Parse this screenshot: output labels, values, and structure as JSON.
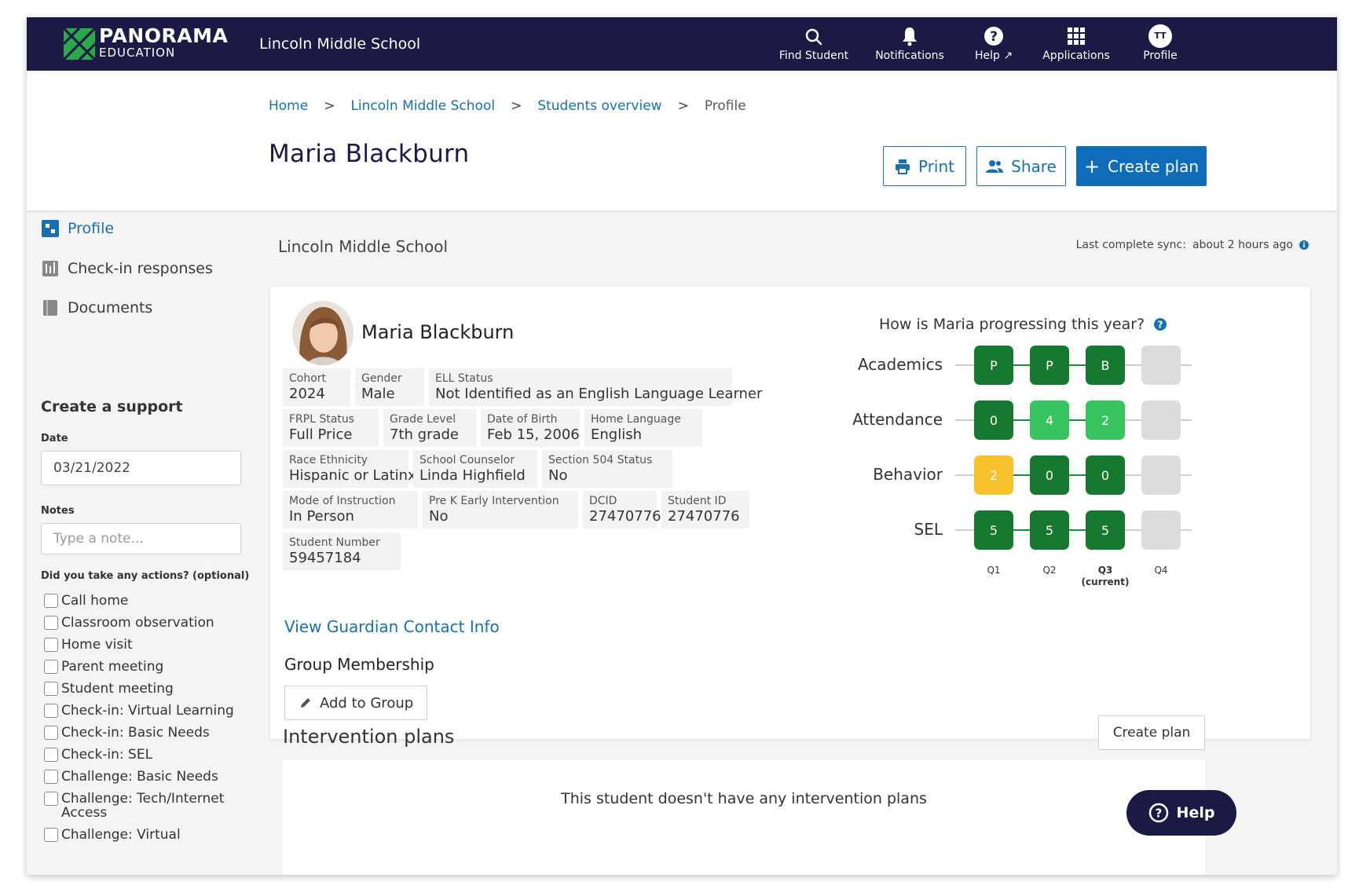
{
  "nav": {
    "brand_line1": "PANORAMA",
    "brand_line2": "EDUCATION",
    "school": "Lincoln Middle School",
    "items": [
      {
        "label": "Find Student",
        "icon": "search-icon"
      },
      {
        "label": "Notifications",
        "icon": "bell-icon"
      },
      {
        "label": "Help",
        "icon": "question-icon"
      },
      {
        "label": "Applications",
        "icon": "grid-icon"
      },
      {
        "label": "Profile",
        "icon": "avatar",
        "initials": "TT"
      }
    ]
  },
  "breadcrumb": [
    "Home",
    "Lincoln Middle School",
    "Students overview",
    "Profile"
  ],
  "breadcrumb_sep": ">",
  "page_title": "Maria Blackburn",
  "actions": {
    "print": "Print",
    "share": "Share",
    "create_plan": "Create plan"
  },
  "sidebar": {
    "links": [
      "Profile",
      "Check-in responses",
      "Documents"
    ],
    "support_title": "Create a support",
    "date_label": "Date",
    "date_value": "03/21/2022",
    "notes_label": "Notes",
    "notes_placeholder": "Type a note...",
    "actions_label": "Did you take any actions? (optional)",
    "checkboxes": [
      "Call home",
      "Classroom observation",
      "Home visit",
      "Parent meeting",
      "Student meeting",
      "Check-in: Virtual Learning",
      "Check-in: Basic Needs",
      "Check-in: SEL",
      "Challenge: Basic Needs",
      "Challenge: Tech/Internet Access",
      "Challenge: Virtual"
    ]
  },
  "content": {
    "school": "Lincoln Middle School",
    "sync_label": "Last complete sync:",
    "sync_value": "about 2 hours ago"
  },
  "student": {
    "name": "Maria Blackburn",
    "fields": [
      {
        "k": "Cohort",
        "v": "2024"
      },
      {
        "k": "Gender",
        "v": "Male"
      },
      {
        "k": "ELL Status",
        "v": "Not Identified as an English Language Learner"
      },
      {
        "k": "FRPL Status",
        "v": "Full Price"
      },
      {
        "k": "Grade Level",
        "v": "7th grade"
      },
      {
        "k": "Date of Birth",
        "v": "Feb 15, 2006"
      },
      {
        "k": "Home Language",
        "v": "English"
      },
      {
        "k": "Race Ethnicity",
        "v": "Hispanic or Latinx"
      },
      {
        "k": "School Counselor",
        "v": "Linda Highfield"
      },
      {
        "k": "Section 504 Status",
        "v": "No"
      },
      {
        "k": "Mode of Instruction",
        "v": "In Person"
      },
      {
        "k": "Pre K Early Intervention",
        "v": "No"
      },
      {
        "k": "DCID",
        "v": "27470776"
      },
      {
        "k": "Student ID",
        "v": "27470776"
      },
      {
        "k": "Student Number",
        "v": "59457184"
      }
    ],
    "guardian_link": "View Guardian Contact Info",
    "group_title": "Group Membership",
    "add_group": "Add to Group"
  },
  "progress": {
    "question": "How is Maria progressing this year?",
    "rows": [
      {
        "label": "Academics",
        "values": [
          "P",
          "P",
          "B",
          ""
        ],
        "colors": [
          "#17782f",
          "#17782f",
          "#17782f",
          "#dcdcdc"
        ]
      },
      {
        "label": "Attendance",
        "values": [
          "0",
          "4",
          "2",
          ""
        ],
        "colors": [
          "#17782f",
          "#38c35f",
          "#38c35f",
          "#dcdcdc"
        ]
      },
      {
        "label": "Behavior",
        "values": [
          "2",
          "0",
          "0",
          ""
        ],
        "colors": [
          "#f6c22d",
          "#17782f",
          "#17782f",
          "#dcdcdc"
        ]
      },
      {
        "label": "SEL",
        "values": [
          "5",
          "5",
          "5",
          ""
        ],
        "colors": [
          "#17782f",
          "#17782f",
          "#17782f",
          "#dcdcdc"
        ]
      }
    ],
    "quarters": [
      "Q1",
      "Q2",
      "Q3",
      "Q4"
    ],
    "current_note": "(current)"
  },
  "interventions": {
    "title": "Intervention plans",
    "create_plan": "Create plan",
    "empty": "This student doesn't have any intervention plans"
  },
  "help_fab": "Help"
}
